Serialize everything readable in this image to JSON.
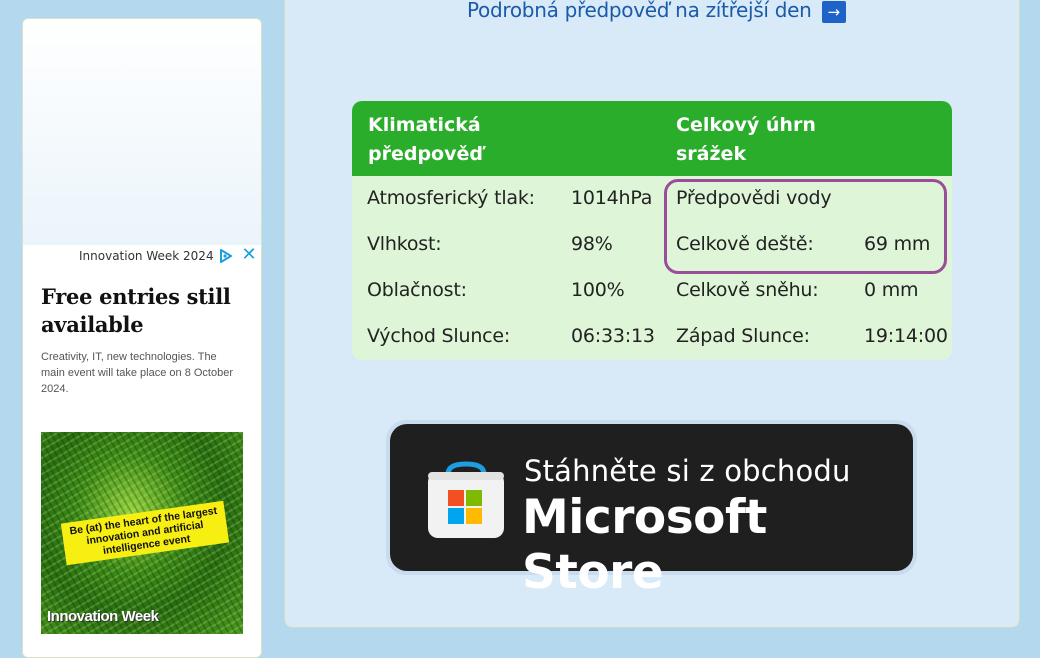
{
  "ad": {
    "sponsor": "Innovation Week 2024",
    "headline": "Free entries still available",
    "description": "Creativity, IT, new technologies. The main event will take place on 8 October 2024.",
    "image_tagline": "Be (at) the heart of the largest innovation and artificial intelligence event",
    "image_brand": "Innovation Week",
    "close_icon": "close-icon",
    "adchoices_icon": "adchoices-icon",
    "accent_color": "#1aa0dc"
  },
  "main": {
    "forecast_link": "Podrobná předpověď na zítřejší den",
    "forecast_link_arrow": "→"
  },
  "climate_table": {
    "header_left": "Klimatická předpověď",
    "header_right": "Celkový úhrn srážek",
    "rows": [
      {
        "label": "Atmosferický tlak:",
        "value": "1014hPa",
        "label2": "Předpovědi vody",
        "value2": ""
      },
      {
        "label": "Vlhkost:",
        "value": "98%",
        "label2": "Celkově deště:",
        "value2": "69 mm"
      },
      {
        "label": "Oblačnost:",
        "value": "100%",
        "label2": "Celkově sněhu:",
        "value2": "0 mm"
      },
      {
        "label": "Východ Slunce:",
        "value": "06:33:13",
        "label2": "Západ Slunce:",
        "value2": "19:14:00"
      }
    ],
    "header_color": "#2aad2a",
    "body_color": "#dff5d8",
    "highlight_color": "#9a4e9a"
  },
  "store_badge": {
    "subtitle": "Stáhněte si z obchodu",
    "name": "Microsoft Store",
    "icon": "microsoft-store-icon"
  }
}
